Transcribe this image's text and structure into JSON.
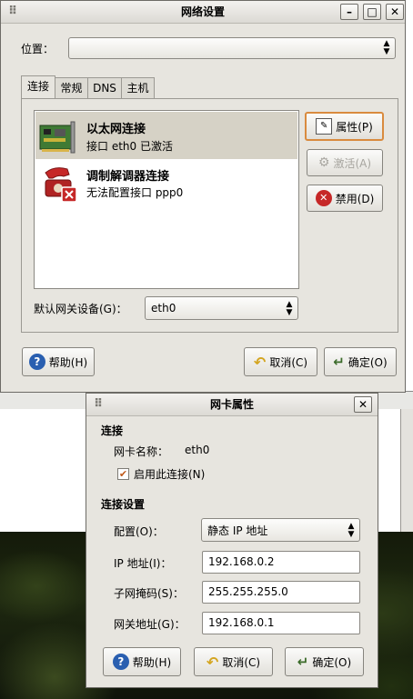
{
  "main_window": {
    "title": "网络设置",
    "location_label": "位置：",
    "location_value": "",
    "tabs": [
      {
        "label": "连接"
      },
      {
        "label": "常规"
      },
      {
        "label": "DNS"
      },
      {
        "label": "主机"
      }
    ],
    "connections": [
      {
        "title": "以太网连接",
        "subtitle": "接口 eth0 已激活",
        "icon": "network-card-icon",
        "selected": true
      },
      {
        "title": "调制解调器连接",
        "subtitle": "无法配置接口 ppp0",
        "icon": "modem-phone-icon",
        "selected": false
      }
    ],
    "side_buttons": {
      "properties": "属性(P)",
      "activate": "激活(A)",
      "deactivate": "禁用(D)"
    },
    "gateway_label": "默认网关设备(G)：",
    "gateway_value": "eth0",
    "help": "帮助(H)",
    "cancel": "取消(C)",
    "ok": "确定(O)"
  },
  "dialog": {
    "title": "网卡属性",
    "section_connection": "连接",
    "card_name_label": "网卡名称：",
    "card_name_value": "eth0",
    "enable_label": "启用此连接(N)",
    "enable_checked": true,
    "section_settings": "连接设置",
    "config_label": "配置(O)：",
    "config_value": "静态 IP 地址",
    "ip_label": "IP 地址(I)：",
    "ip_value": "192.168.0.2",
    "mask_label": "子网掩码(S)：",
    "mask_value": "255.255.255.0",
    "gateway_label": "网关地址(G)：",
    "gateway_value": "192.168.0.1",
    "help": "帮助(H)",
    "cancel": "取消(C)",
    "ok": "确定(O)"
  },
  "colors": {
    "window_bg": "#e7e5df",
    "selection": "#d6d2c6",
    "focus_border": "#d98b3f",
    "help_icon": "#2a5fb0",
    "stop_icon": "#c62828"
  }
}
